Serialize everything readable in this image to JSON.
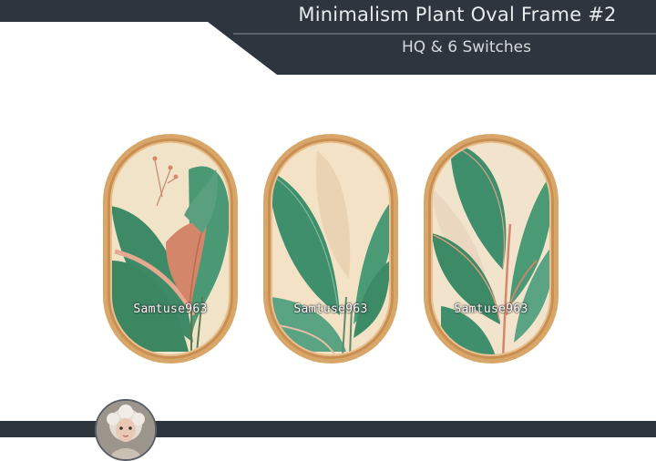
{
  "header": {
    "title": "Minimalism Plant Oval Frame #2",
    "subtitle": "HQ & 6 Switches"
  },
  "frames": [
    {
      "watermark": "Samtuse963",
      "subject": "pink-tipped tropical leaves with flower stems"
    },
    {
      "watermark": "Samtuse963",
      "subject": "green banana leaves on beige"
    },
    {
      "watermark": "Samtuse963",
      "subject": "green calathea leaves with pink stems"
    }
  ],
  "colors": {
    "banner": "#2f353e",
    "frame_wood": "#d9a66a",
    "leaf_green": "#3f8f6c",
    "leaf_pink": "#d4866a",
    "background_cream": "#f1e3c8"
  },
  "icons": {
    "avatar": "creator-avatar-doll"
  }
}
